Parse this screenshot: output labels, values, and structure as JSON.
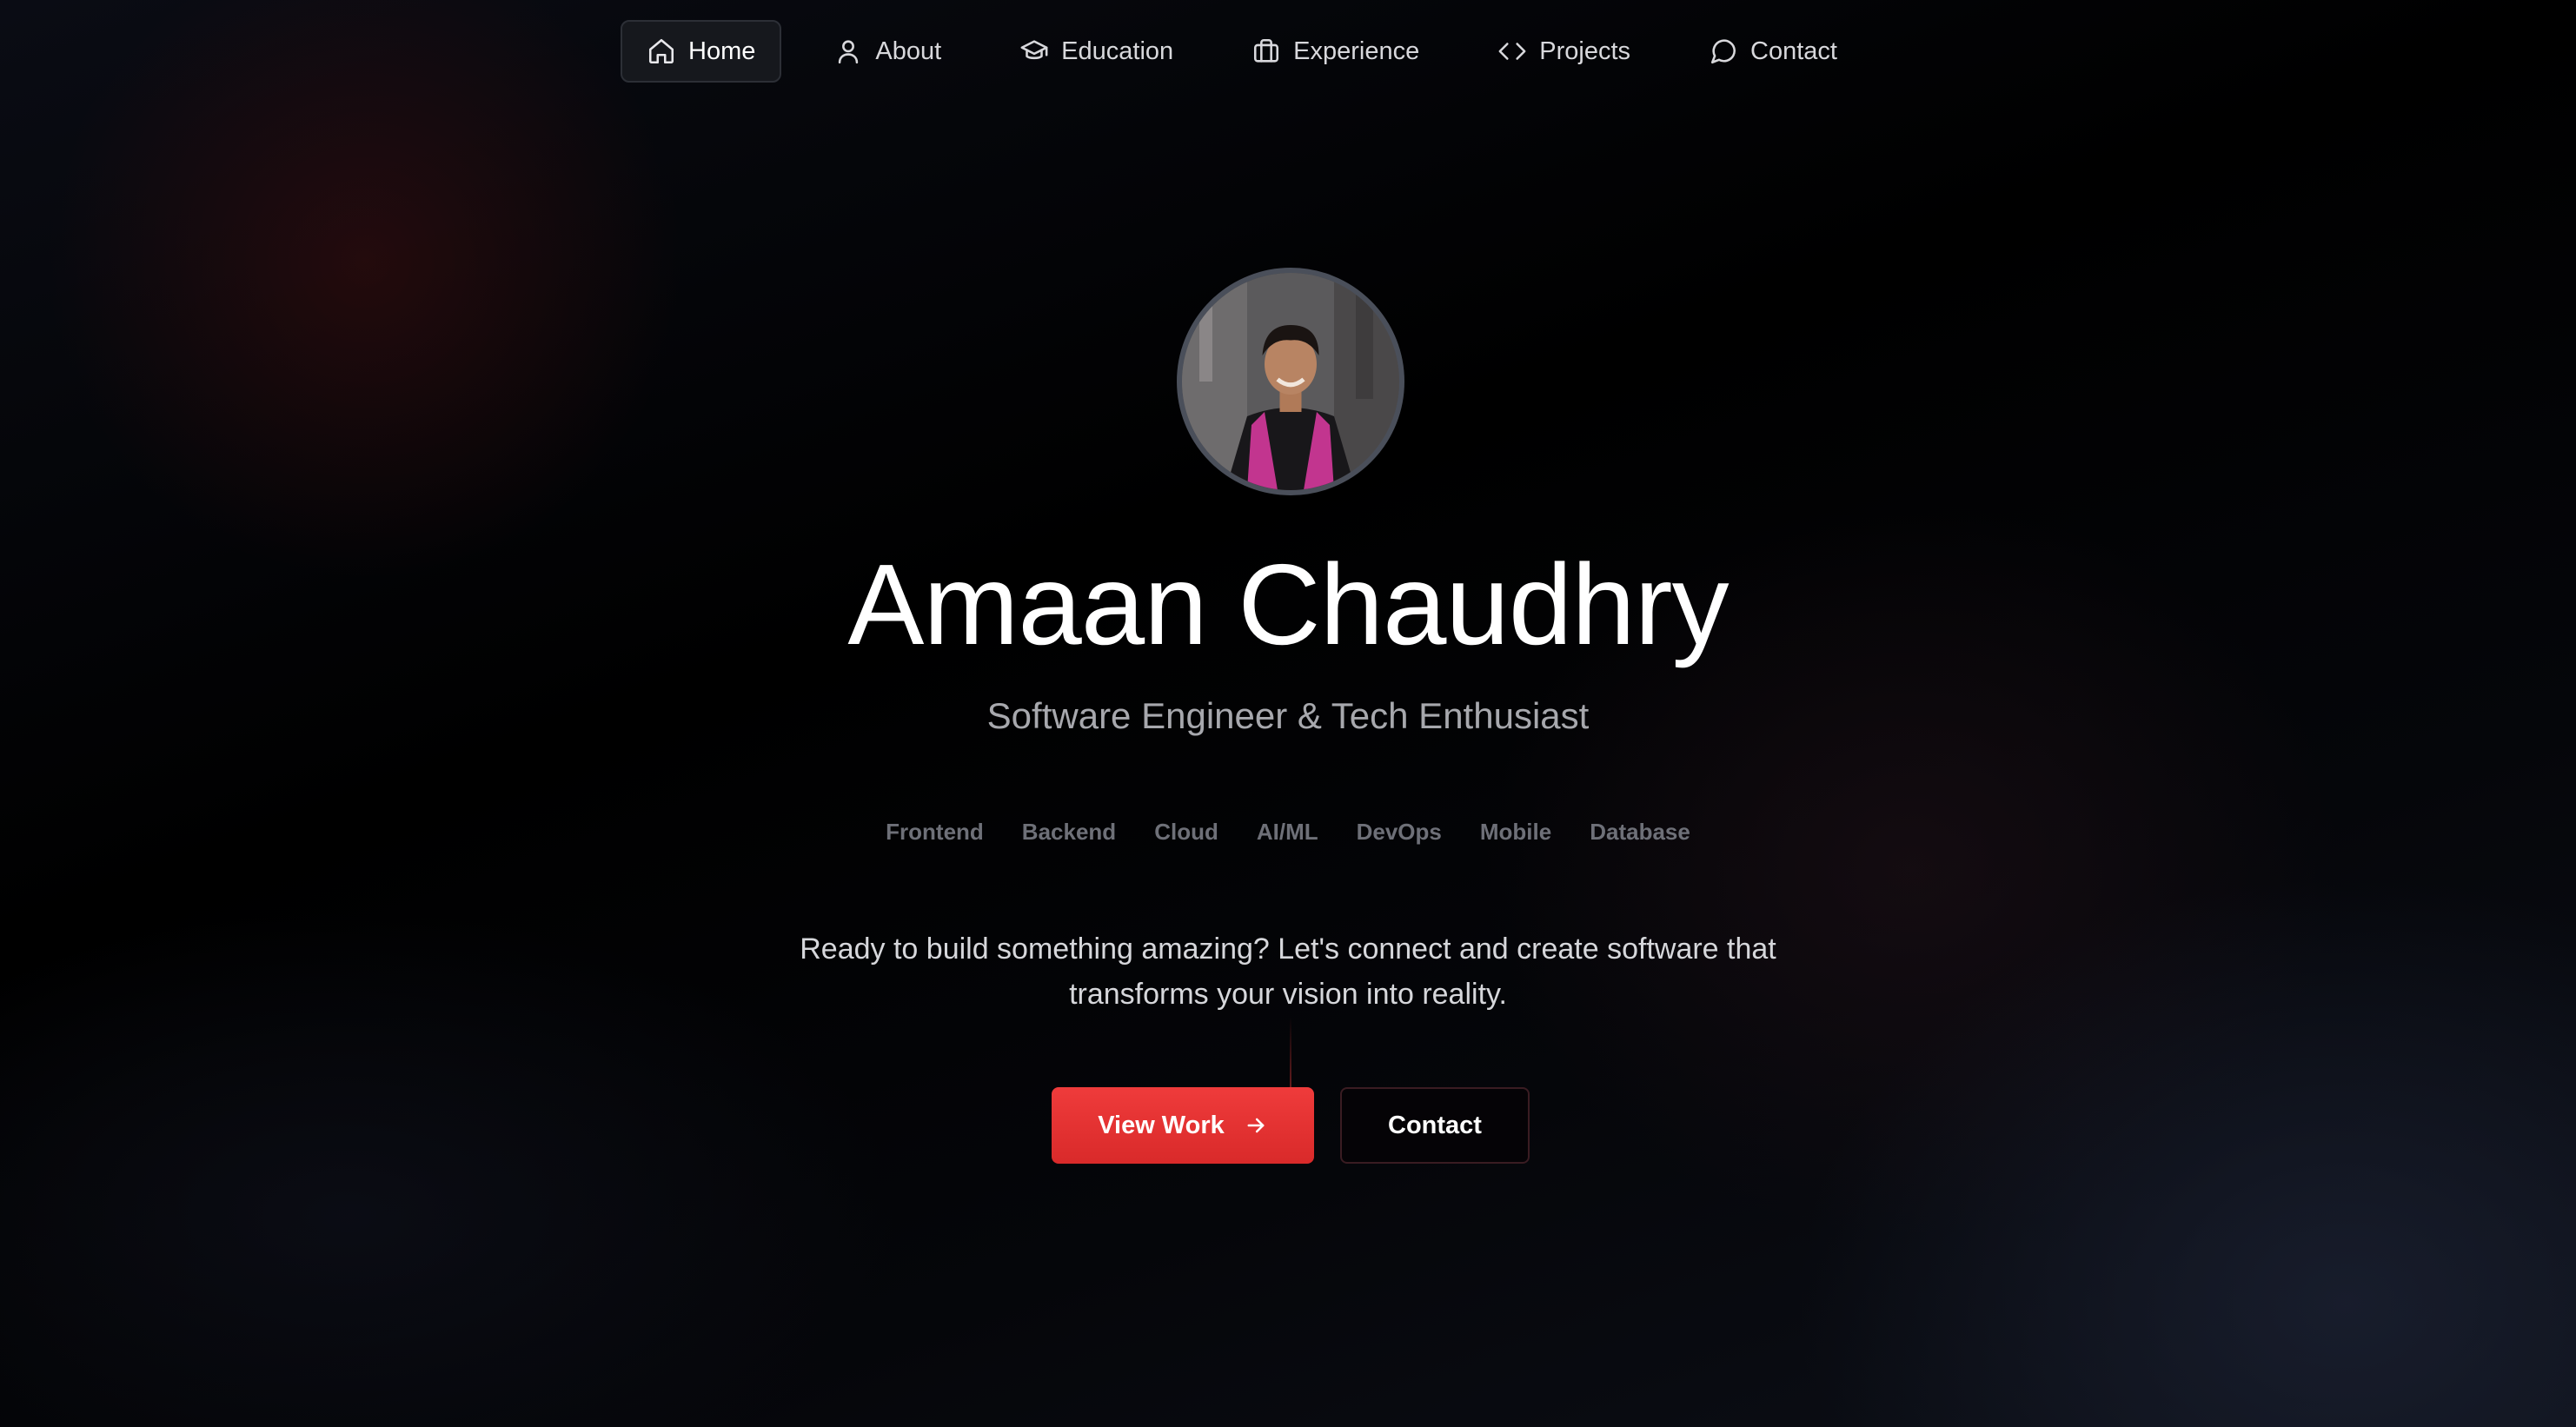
{
  "nav": {
    "items": [
      {
        "label": "Home",
        "icon": "home-icon",
        "active": true
      },
      {
        "label": "About",
        "icon": "user-icon"
      },
      {
        "label": "Education",
        "icon": "graduation-cap-icon"
      },
      {
        "label": "Experience",
        "icon": "briefcase-icon"
      },
      {
        "label": "Projects",
        "icon": "code-icon"
      },
      {
        "label": "Contact",
        "icon": "message-circle-icon"
      }
    ]
  },
  "hero": {
    "name": "Amaan Chaudhry",
    "subtitle": "Software Engineer & Tech Enthusiast",
    "tags": [
      "Frontend",
      "Backend",
      "Cloud",
      "AI/ML",
      "DevOps",
      "Mobile",
      "Database"
    ],
    "description": "Ready to build something amazing? Let's connect and create software that transforms your vision into reality.",
    "primary_button": "View Work",
    "secondary_button": "Contact"
  },
  "colors": {
    "accent": "#e53535",
    "background": "#000000"
  }
}
